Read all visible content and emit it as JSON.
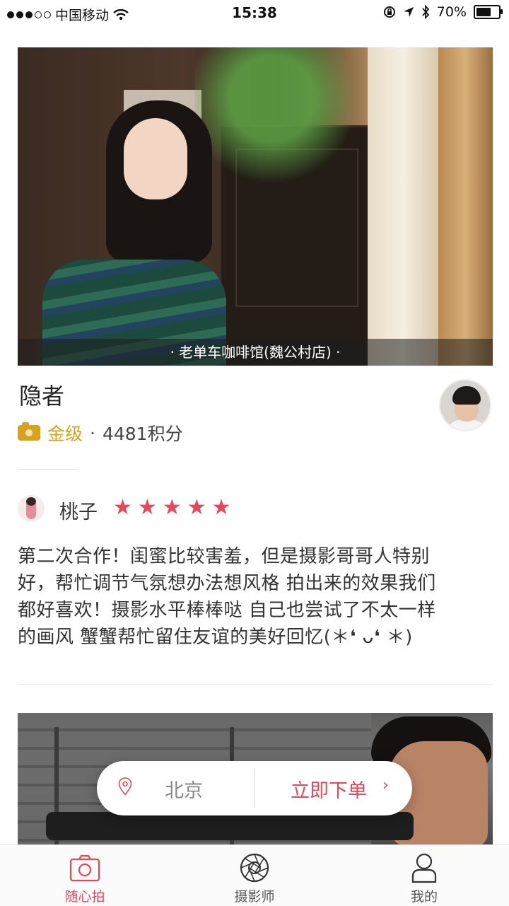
{
  "status_bar": {
    "carrier": "中国移动",
    "time": "15:38",
    "battery": "70%",
    "battery_level": 0.7
  },
  "card": {
    "photo_caption": "· 老单车咖啡馆(魏公村店) ·",
    "author_name": "隐者",
    "level": "金级",
    "separator": "·",
    "points": "4481积分",
    "accent_color": "#e8475a",
    "level_color": "#d8a31c"
  },
  "review": {
    "reviewer": "桃子",
    "rating": 5,
    "stars": [
      "★",
      "★",
      "★",
      "★",
      "★"
    ],
    "lines": [
      "第二次合作！闺蜜比较害羞，但是摄影哥哥人特别",
      "好，帮忙调节气氛想办法想风格 拍出来的效果我们",
      "都好喜欢！摄影水平棒棒哒 自己也尝试了不太一样",
      "的画风 蟹蟹帮忙留住友谊的美好回忆(＊❛ ᴗ❛ ＊)"
    ]
  },
  "order_pill": {
    "city": "北京",
    "action": "立即下单",
    "chevron": "›"
  },
  "tabbar": {
    "tabs": [
      {
        "label": "随心拍",
        "icon": "camera-icon",
        "active": true
      },
      {
        "label": "摄影师",
        "icon": "aperture-icon",
        "active": false
      },
      {
        "label": "我的",
        "icon": "user-icon",
        "active": false
      }
    ]
  }
}
